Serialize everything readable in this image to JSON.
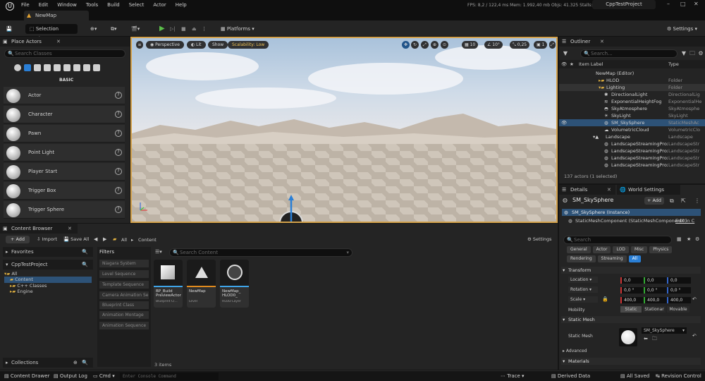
{
  "menu": [
    "File",
    "Edit",
    "Window",
    "Tools",
    "Build",
    "Select",
    "Actor",
    "Help"
  ],
  "map_tab": "NewMap",
  "stats": "FPS: 8,2  /  122,4 ms   Mem: 1.992,40 mb   Objs: 41.325   Stalls: 0",
  "project_tab": "CppTestProject",
  "toolbar": {
    "selection_mode": "Selection Mode",
    "platforms": "Platforms",
    "settings": "Settings"
  },
  "place_actors": {
    "title": "Place Actors",
    "search_placeholder": "Search Classes",
    "category": "BASIC",
    "items": [
      "Actor",
      "Character",
      "Pawn",
      "Point Light",
      "Player Start",
      "Trigger Box",
      "Trigger Sphere"
    ]
  },
  "viewport": {
    "perspective": "Perspective",
    "lit": "Lit",
    "show": "Show",
    "scalability": "Scalability: Low",
    "grid": "10",
    "rotation": "10°",
    "scale": "0,25",
    "camera": "1"
  },
  "outliner": {
    "title": "Outliner",
    "search_placeholder": "Search...",
    "col_label": "Item Label",
    "col_type": "Type",
    "rows": [
      {
        "name": "NewMap (Editor)",
        "type": ""
      },
      {
        "name": "HLOD",
        "type": "Folder"
      },
      {
        "name": "Lighting",
        "type": "Folder"
      },
      {
        "name": "DirectionalLight",
        "type": "DirectionalLig"
      },
      {
        "name": "ExponentialHeightFog",
        "type": "ExponentialHe"
      },
      {
        "name": "SkyAtmosphere",
        "type": "SkyAtmosphe"
      },
      {
        "name": "SkyLight",
        "type": "SkyLight"
      },
      {
        "name": "SM_SkySphere",
        "type": "StaticMeshAc"
      },
      {
        "name": "VolumetricCloud",
        "type": "VolumetricClo"
      },
      {
        "name": "Landscape",
        "type": "Landscape"
      },
      {
        "name": "LandscapeStreamingProxy",
        "type": "LandscapeStr"
      },
      {
        "name": "LandscapeStreamingProxy",
        "type": "LandscapeStr"
      },
      {
        "name": "LandscapeStreamingProxy",
        "type": "LandscapeStr"
      },
      {
        "name": "LandscapeStreamingProxy",
        "type": "LandscapeStr"
      }
    ],
    "footer": "137 actors (1 selected)"
  },
  "details": {
    "tab": "Details",
    "tab2": "World Settings",
    "object": "SM_SkySphere",
    "add": "+ Add",
    "instance": "SM_SkySphere (Instance)",
    "component": "StaticMeshComponent (StaticMeshComponent0)",
    "edit": "Edit in C",
    "search_placeholder": "Search",
    "filters": [
      "General",
      "Actor",
      "LOD",
      "Misc",
      "Physics",
      "Rendering",
      "Streaming",
      "All"
    ],
    "transform": "Transform",
    "location": "Location",
    "rotation": "Rotation",
    "scale": "Scale",
    "loc_vals": [
      "0,0",
      "0,0",
      "0,0"
    ],
    "rot_vals": [
      "0,0 °",
      "0,0 °",
      "0,0 °"
    ],
    "scale_vals": [
      "400,0",
      "400,0",
      "400,0"
    ],
    "mobility": "Mobility",
    "mobility_opts": [
      "Static",
      "Stationar",
      "Movable"
    ],
    "static_mesh_section": "Static Mesh",
    "static_mesh_label": "Static Mesh",
    "static_mesh_value": "SM_SkySphere",
    "advanced": "Advanced",
    "materials": "Materials"
  },
  "content_browser": {
    "title": "Content Browser",
    "add": "+ Add",
    "import": "Import",
    "save_all": "Save All",
    "path": [
      "All",
      "Content"
    ],
    "settings": "Settings",
    "favorites": "Favorites",
    "project": "CppTestProject",
    "tree": [
      "All",
      "Content",
      "C++ Classes",
      "Engine"
    ],
    "filters_title": "Filters",
    "filters": [
      "Niagara System",
      "Level Sequence",
      "Template Sequence",
      "Camera Animation Se",
      "Blueprint Class",
      "Animation Montage",
      "Animation Sequence"
    ],
    "search_placeholder": "Search Content",
    "assets": [
      {
        "name": "BP_Build PreviewActor",
        "sub": "Blueprint Cl..."
      },
      {
        "name": "NewMap",
        "sub": "Level"
      },
      {
        "name": "NewMap_ HLOD0_",
        "sub": "HLOD Layer"
      }
    ],
    "count": "3 items",
    "collections": "Collections"
  },
  "status": {
    "drawer": "Content Drawer",
    "log": "Output Log",
    "cmd": "Cmd",
    "console_placeholder": "Enter Console Command",
    "trace": "Trace",
    "derived": "Derived Data",
    "saved": "All Saved",
    "revision": "Revision Control"
  }
}
